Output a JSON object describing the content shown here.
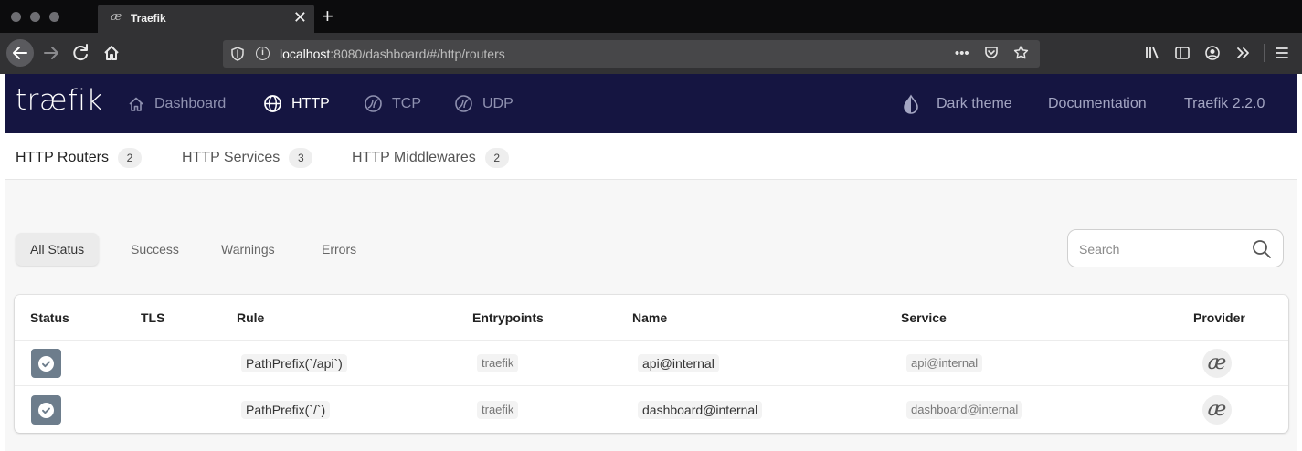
{
  "browser": {
    "tab_title": "Traefik",
    "tab_icon_glyph": "æ",
    "tab_close": "✕",
    "new_tab": "+",
    "url_host": "localhost",
    "url_rest": ":8080/dashboard/#/http/routers",
    "icons": [
      "back-arrow-icon",
      "forward-arrow-icon",
      "reload-icon",
      "home-icon",
      "shield-icon",
      "info-icon",
      "more-icon",
      "pocket-icon",
      "bookmark-star-icon",
      "library-icon",
      "sidebar-icon",
      "account-icon",
      "overflow-icon",
      "hamburger-menu-icon"
    ]
  },
  "header": {
    "logo": "træfik",
    "nav": [
      {
        "label": "Dashboard",
        "icon": "home-icon"
      },
      {
        "label": "HTTP",
        "icon": "globe-icon",
        "active": true
      },
      {
        "label": "TCP",
        "icon": "tcp-icon"
      },
      {
        "label": "UDP",
        "icon": "udp-icon"
      }
    ],
    "right": {
      "theme_label": "Dark theme",
      "theme_icon": "contrast-drop-icon",
      "docs_label": "Documentation",
      "version_label": "Traefik 2.2.0"
    }
  },
  "subtabs": [
    {
      "label": "HTTP Routers",
      "count": "2",
      "active": true
    },
    {
      "label": "HTTP Services",
      "count": "3"
    },
    {
      "label": "HTTP Middlewares",
      "count": "2"
    }
  ],
  "filters": [
    {
      "label": "All Status",
      "active": true
    },
    {
      "label": "Success"
    },
    {
      "label": "Warnings"
    },
    {
      "label": "Errors"
    }
  ],
  "search": {
    "placeholder": "Search",
    "icon": "search-icon"
  },
  "table": {
    "columns": [
      "Status",
      "TLS",
      "Rule",
      "Entrypoints",
      "Name",
      "Service",
      "Provider"
    ],
    "rows": [
      {
        "status": "success",
        "tls": "",
        "rule": "PathPrefix(`/api`)",
        "entrypoints": "traefik",
        "name": "api@internal",
        "service": "api@internal",
        "provider_glyph": "æ"
      },
      {
        "status": "success",
        "tls": "",
        "rule": "PathPrefix(`/`)",
        "entrypoints": "traefik",
        "name": "dashboard@internal",
        "service": "dashboard@internal",
        "provider_glyph": "æ"
      }
    ]
  },
  "colors": {
    "header_bg": "#151541",
    "status_success": "#6d7d8c",
    "browser_dark": "#323234"
  }
}
